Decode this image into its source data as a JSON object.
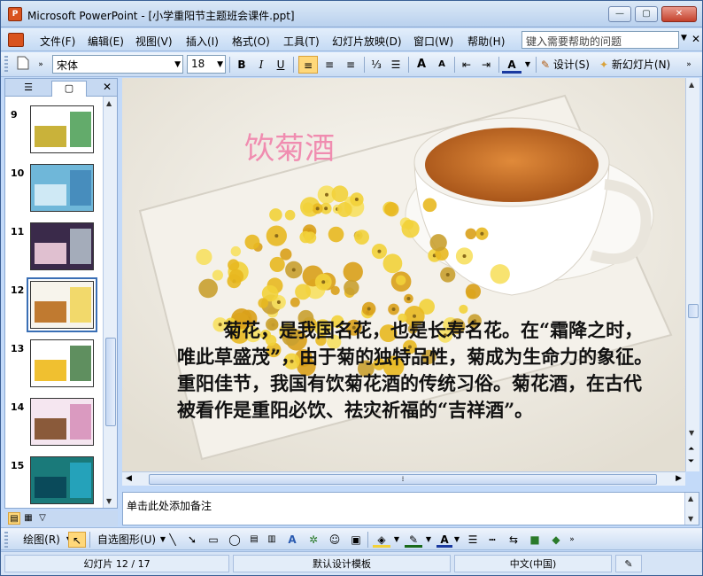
{
  "window": {
    "app_icon": "powerpoint-icon",
    "title": "Microsoft PowerPoint - [小学重阳节主题班会课件.ppt]",
    "minimize": "—",
    "maximize": "▢",
    "close": "✕"
  },
  "menu": {
    "items": [
      "文件(F)",
      "编辑(E)",
      "视图(V)",
      "插入(I)",
      "格式(O)",
      "工具(T)",
      "幻灯片放映(D)",
      "窗口(W)",
      "帮助(H)"
    ],
    "help_placeholder": "键入需要帮助的问题",
    "close_doc": "✕"
  },
  "toolbar": {
    "font_name": "宋体",
    "font_size": "18",
    "bold": "B",
    "italic": "I",
    "underline": "U",
    "align_left": "≡",
    "align_center": "≡",
    "align_right": "≡",
    "numbering": "⅓",
    "bullets": "☰",
    "grow_font": "A",
    "shrink_font": "A",
    "decrease_indent": "⇤",
    "increase_indent": "⇥",
    "font_color": "A",
    "design_label": "设计(S)",
    "new_slide_label": "新幻灯片(N)"
  },
  "left_panel": {
    "tab_outline": "☰",
    "tab_slides": "▢",
    "close": "✕",
    "slides": [
      {
        "num": "9",
        "colors": [
          "#ffffff",
          "#2f8f3a",
          "#c9b23a"
        ]
      },
      {
        "num": "10",
        "colors": [
          "#6fb7d9",
          "#3a7fb3",
          "#cfe9f5"
        ]
      },
      {
        "num": "11",
        "colors": [
          "#3a2a4a",
          "#c8d8e0",
          "#e0c0d0"
        ]
      },
      {
        "num": "12",
        "colors": [
          "#f7f4ec",
          "#f0d040",
          "#c07a30"
        ],
        "selected": true
      },
      {
        "num": "13",
        "colors": [
          "#ffffff",
          "#2a6a2a",
          "#f0c030"
        ]
      },
      {
        "num": "14",
        "colors": [
          "#f5e6f0",
          "#d080b0",
          "#8a5a3a"
        ]
      },
      {
        "num": "15",
        "colors": [
          "#1a7a7a",
          "#2ab0d0",
          "#0a4a5a"
        ]
      }
    ]
  },
  "slide": {
    "title": "饮菊酒",
    "body": "菊花，是我国名花，也是长寿名花。在“霜降之时，唯此草盛茂”，由于菊的独特品性，菊成为生命力的象征。重阳佳节，我国有饮菊花酒的传统习俗。菊花酒，在古代被看作是重阳必饮、祛灾祈福的“吉祥酒”。"
  },
  "notes": {
    "placeholder": "单击此处添加备注"
  },
  "drawing": {
    "draw_menu": "绘图(R)",
    "autoshapes_menu": "自选图形(U)"
  },
  "status": {
    "slide_info": "幻灯片 12 / 17",
    "design_template": "默认设计模板",
    "language": "中文(中国)"
  },
  "colors": {
    "accent": "#3a6fb5",
    "title_pink": "#f08cb0",
    "tea": "#c8702a"
  }
}
